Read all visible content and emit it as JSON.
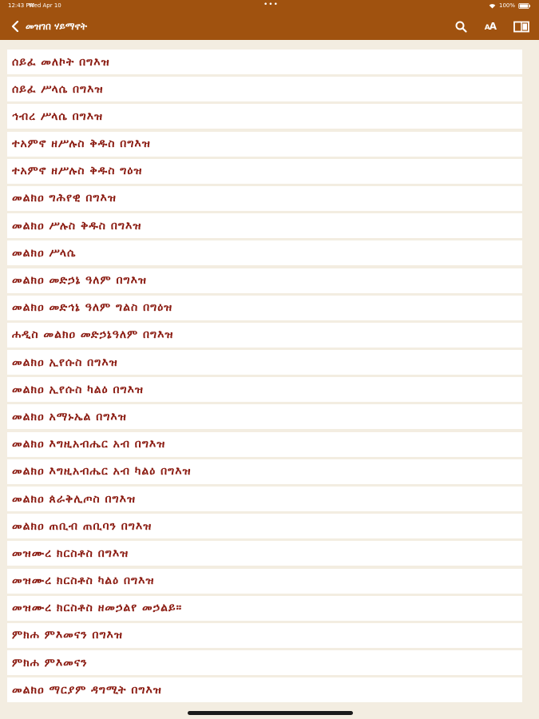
{
  "status_bar": {
    "time": "12:43 PM",
    "date": "Wed Apr 10",
    "dots": "•••",
    "battery": "100%"
  },
  "header": {
    "title": "መዝገበ ሃይማኖት",
    "back_icon": "chevron-left-icon",
    "actions": [
      {
        "name": "search-icon"
      },
      {
        "name": "font-size-icon",
        "label_big": "A",
        "label_small": "A"
      },
      {
        "name": "book-icon"
      }
    ]
  },
  "colors": {
    "header_bg": "#a0520f",
    "item_text": "#8b1c12",
    "page_bg": "#f3ede1"
  },
  "items": [
    {
      "label": "ሰይፈ መለኮት በግእዝ"
    },
    {
      "label": "ሰይፈ ሥላሴ በግእዝ"
    },
    {
      "label": "ኅብረ ሥላሴ በግእዝ"
    },
    {
      "label": "ተአምኖ ዘሥሉስ ቅዱስ በግእዝ"
    },
    {
      "label": "ተአምኖ ዘሥሉስ ቅዱስ ግዕዝ"
    },
    {
      "label": "መልክዐ ግሕየዊ በግእዝ"
    },
    {
      "label": "መልክዐ ሥሉስ ቅዱስ በግእዝ"
    },
    {
      "label": "መልክዐ ሥላሴ"
    },
    {
      "label": "መልክዐ መድኃኔ ዓለም በግእዝ"
    },
    {
      "label": "መልክዐ መድኅኔ ዓለም ግልስ በግዕዝ"
    },
    {
      "label": "ሐዲስ መልክዐ መድኃኔዓለም በግእዝ"
    },
    {
      "label": "መልክዐ ኢየሱስ በግእዝ"
    },
    {
      "label": "መልክዐ ኢየሱስ ካልዕ በግእዝ"
    },
    {
      "label": "መልክዐ አማኑኤል በግእዝ"
    },
    {
      "label": "መልክዐ እግዚአብሔር አብ በግእዝ"
    },
    {
      "label": "መልክዐ እግዚአብሔር አብ ካልዕ በግእዝ"
    },
    {
      "label": "መልክዐ ጰራቅሊጦስ በግእዝ"
    },
    {
      "label": "መልክዐ ጠቢብ ጠቢባን በግእዝ"
    },
    {
      "label": "መዝሙረ ክርስቶስ በግእዝ"
    },
    {
      "label": "መዝሙረ ክርስቶስ ካልዕ በግእዝ"
    },
    {
      "label": "መዝሙረ ክርስቶስ ዘመኃልየ መኃልይ።"
    },
    {
      "label": "ምክሐ ምእመናን በግእዝ"
    },
    {
      "label": "ምክሐ ምእመናን"
    },
    {
      "label": "መልክዐ ማርያም ዳግሚት በግእዝ"
    }
  ]
}
